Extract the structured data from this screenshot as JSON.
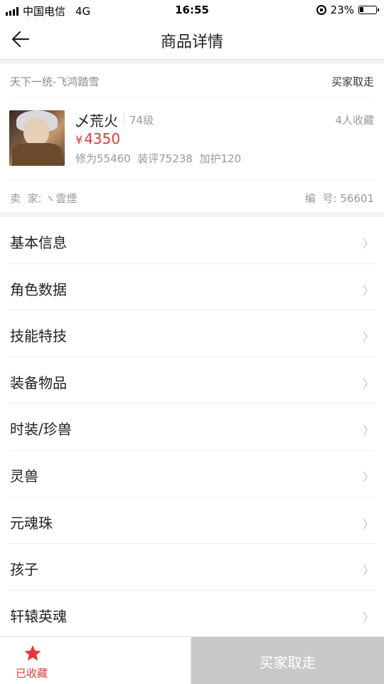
{
  "statusbar": {
    "carrier": "中国电信",
    "network": "4G",
    "time": "16:55",
    "battery": "23%",
    "battery_level": 0.23
  },
  "navbar": {
    "title": "商品详情",
    "back_icon": "arrow-left-icon"
  },
  "product": {
    "server": "天下一统-飞鸿踏雪",
    "trade_status": "买家取走",
    "name": "乄荒火",
    "level": "74级",
    "favorites": "4人收藏",
    "price_symbol": "¥",
    "price": "4350",
    "stats": "修为55460  装评75238  加护120",
    "seller": "卖  家: ヽ雲煙",
    "number": "编  号: 56601"
  },
  "menu": {
    "items": [
      {
        "label": "基本信息"
      },
      {
        "label": "角色数据"
      },
      {
        "label": "技能特技"
      },
      {
        "label": "装备物品"
      },
      {
        "label": "时装/珍兽"
      },
      {
        "label": "灵兽"
      },
      {
        "label": "元魂珠"
      },
      {
        "label": "孩子"
      },
      {
        "label": "轩辕英魂"
      }
    ],
    "chevron": "〉"
  },
  "bottom": {
    "collect_label": "已收藏",
    "collect_icon": "star-icon",
    "buy_label": "买家取走"
  },
  "colors": {
    "accent": "#e4393c",
    "disabled": "#c8c8c8"
  }
}
